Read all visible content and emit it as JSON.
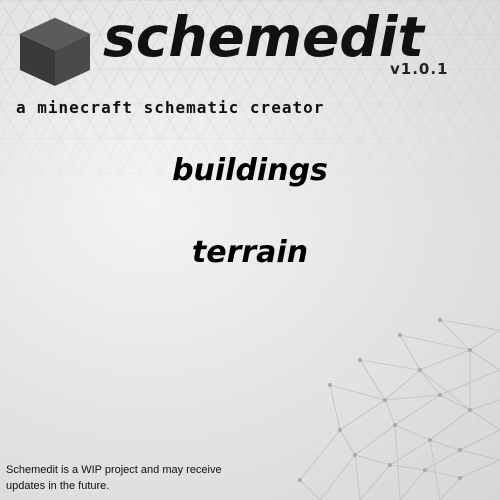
{
  "header": {
    "logo_icon": "cube-icon",
    "title": "schemedit",
    "version": "v1.0.1",
    "subtitle": "a minecraft schematic creator"
  },
  "menu": {
    "buildings_label": "buildings",
    "terrain_label": "terrain"
  },
  "footer": {
    "notice": "Schemedit is a WIP project and may receive updates in the future."
  },
  "colors": {
    "background": "#e6e6e6",
    "text": "#111111",
    "cube_top": "#5b5b5b",
    "cube_left": "#3a3a3a",
    "cube_right": "#4a4a4a"
  }
}
